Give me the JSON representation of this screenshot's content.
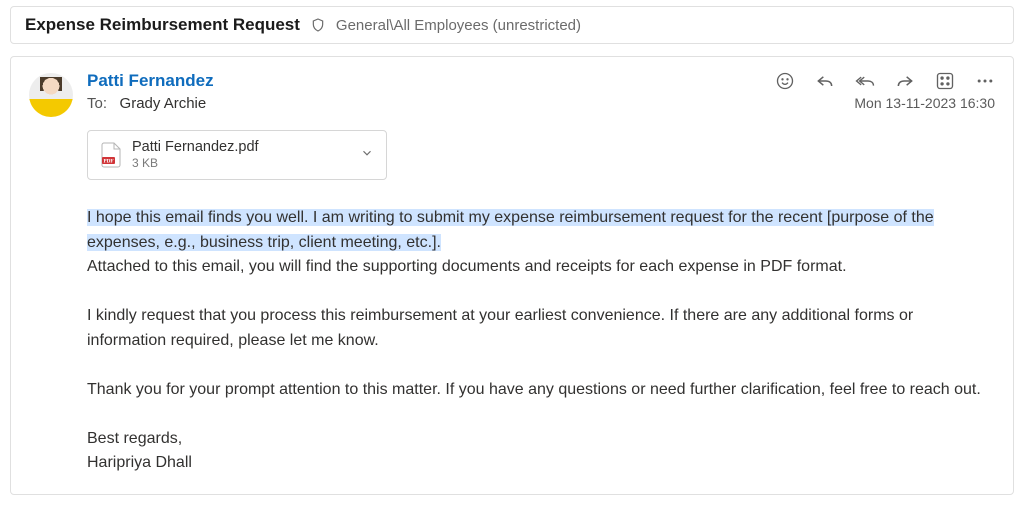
{
  "header": {
    "subject": "Expense Reimbursement Request",
    "classification": "General\\All Employees (unrestricted)"
  },
  "message": {
    "from": "Patti Fernandez",
    "to_label": "To:",
    "to_name": "Grady Archie",
    "timestamp": "Mon 13-11-2023 16:30"
  },
  "attachment": {
    "name": "Patti Fernandez.pdf",
    "size": "3 KB"
  },
  "body": {
    "p1_selected": "I hope this email finds you well. I am writing to submit my expense reimbursement request for the recent [purpose of the expenses, e.g., business trip, client meeting, etc.].",
    "p1_rest": "Attached to this email, you will find the supporting documents and receipts for each expense in PDF format.",
    "p2": "I kindly request that you process this reimbursement at your earliest convenience. If there are any additional forms or information required, please let me know.",
    "p3": "Thank you for your prompt attention to this matter. If you have any questions or need further clarification, feel free to reach out.",
    "signoff": "Best regards,",
    "signature": "Haripriya Dhall"
  },
  "icons": {
    "shield": "shield-icon",
    "smile": "react-icon",
    "reply": "reply-icon",
    "reply_all": "reply-all-icon",
    "forward": "forward-icon",
    "apps": "apps-icon",
    "more": "more-icon",
    "pdf": "pdf-icon",
    "chevron": "chevron-down-icon"
  }
}
